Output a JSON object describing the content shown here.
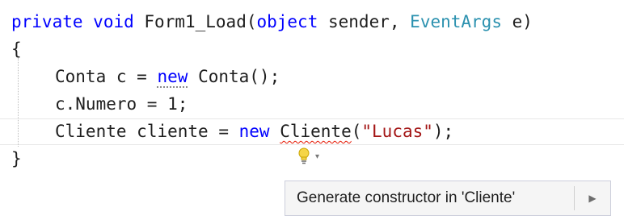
{
  "code": {
    "line1": {
      "kw1": "private",
      "kw2": "void",
      "name": "Form1_Load(",
      "kw3": "object",
      "arg1": "sender,",
      "type1": "EventArgs",
      "arg2": "e)"
    },
    "line2": {
      "text": "{"
    },
    "line3": {
      "type": "Conta",
      "var": "c =",
      "kw": "new",
      "ctor": "Conta();"
    },
    "line4": {
      "text": "c.Numero = 1;"
    },
    "line5": {
      "type": "Cliente",
      "var": "cliente =",
      "kw": "new",
      "ctor": "Cliente",
      "open": "(",
      "str": "\"Lucas\"",
      "close": ");"
    },
    "line6": {
      "text": "}"
    }
  },
  "quick_actions": {
    "icon": "lightbulb-icon",
    "dropdown_icon": "chevron-down-icon",
    "menu_item_label": "Generate constructor in 'Cliente'",
    "submenu_icon": "chevron-right-icon"
  },
  "colors": {
    "keyword": "#0000ff",
    "type": "#2b91af",
    "string": "#a31515",
    "error_squiggle": "#e51400"
  }
}
